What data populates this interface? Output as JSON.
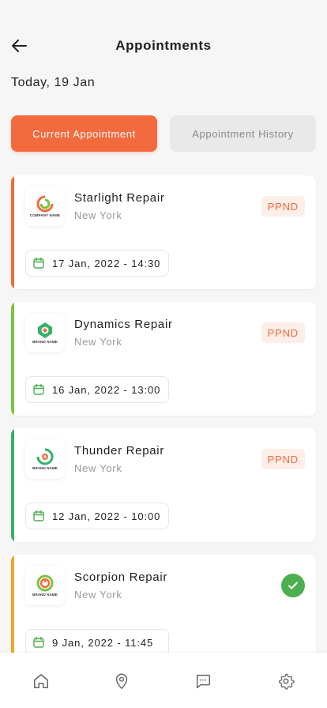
{
  "header": {
    "title": "Appointments"
  },
  "date_line": "Today, 19 Jan",
  "tabs": [
    {
      "label": "Current Appointment",
      "active": true
    },
    {
      "label": "Appointment History",
      "active": false
    }
  ],
  "appointments": [
    {
      "name": "Starlight Repair",
      "city": "New York",
      "status": "PPND",
      "datetime": "17 Jan, 2022 - 14:30",
      "accent": "#f26a3d",
      "logo_caption": "COMPANY NAME"
    },
    {
      "name": "Dynamics Repair",
      "city": "New York",
      "status": "PPND",
      "datetime": "16 Jan, 2022 - 13:00",
      "accent": "#7cc242",
      "logo_caption": "BRAND NAME"
    },
    {
      "name": "Thunder Repair",
      "city": "New York",
      "status": "PPND",
      "datetime": "12 Jan, 2022 - 10:00",
      "accent": "#2fb36a",
      "logo_caption": "BRAND NAME"
    },
    {
      "name": "Scorpion Repair",
      "city": "New York",
      "status": "completed",
      "datetime": "9 Jan, 2022 - 11:45",
      "accent": "#f5a623",
      "logo_caption": "BRAND NAME"
    }
  ],
  "colors": {
    "primary": "#f26a3d",
    "success": "#4caf50",
    "calendar": "#4caf50"
  },
  "bottom_nav": [
    {
      "icon": "home-icon"
    },
    {
      "icon": "location-pin-icon"
    },
    {
      "icon": "chat-icon"
    },
    {
      "icon": "gear-icon"
    }
  ]
}
